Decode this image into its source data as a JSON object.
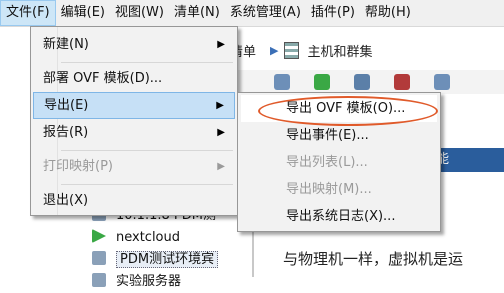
{
  "menubar": {
    "items": [
      "文件(F)",
      "编辑(E)",
      "视图(W)",
      "清单(N)",
      "系统管理(A)",
      "插件(P)",
      "帮助(H)"
    ]
  },
  "background": {
    "crumb_inventory": "清单",
    "crumb_hosts": "主机和群集",
    "tree_items": [
      "10.1.1.8 PDM测",
      "nextcloud",
      "PDM测试环境宾",
      "实验服务器"
    ],
    "blue_label": "能",
    "description": "与物理机一样，虚拟机是运"
  },
  "file_menu": {
    "items": [
      {
        "label": "新建(N)",
        "submenu": true,
        "disabled": false
      },
      {
        "label": "部署 OVF 模板(D)...",
        "submenu": false,
        "disabled": false
      },
      {
        "label": "导出(E)",
        "submenu": true,
        "disabled": false,
        "highlighted": true
      },
      {
        "label": "报告(R)",
        "submenu": true,
        "disabled": false
      },
      {
        "label": "打印映射(P)",
        "submenu": true,
        "disabled": true
      },
      {
        "label": "退出(X)",
        "submenu": false,
        "disabled": false
      }
    ]
  },
  "export_submenu": {
    "items": [
      {
        "label": "导出 OVF 模板(O)...",
        "disabled": false,
        "circled": true
      },
      {
        "label": "导出事件(E)...",
        "disabled": false
      },
      {
        "label": "导出列表(L)...",
        "disabled": true
      },
      {
        "label": "导出映射(M)...",
        "disabled": true
      },
      {
        "label": "导出系统日志(X)...",
        "disabled": false
      }
    ]
  },
  "colors": {
    "highlight": "#c6e0f6",
    "annotation_oval": "#e05a2a",
    "disabled_text": "#9a9a9a"
  }
}
